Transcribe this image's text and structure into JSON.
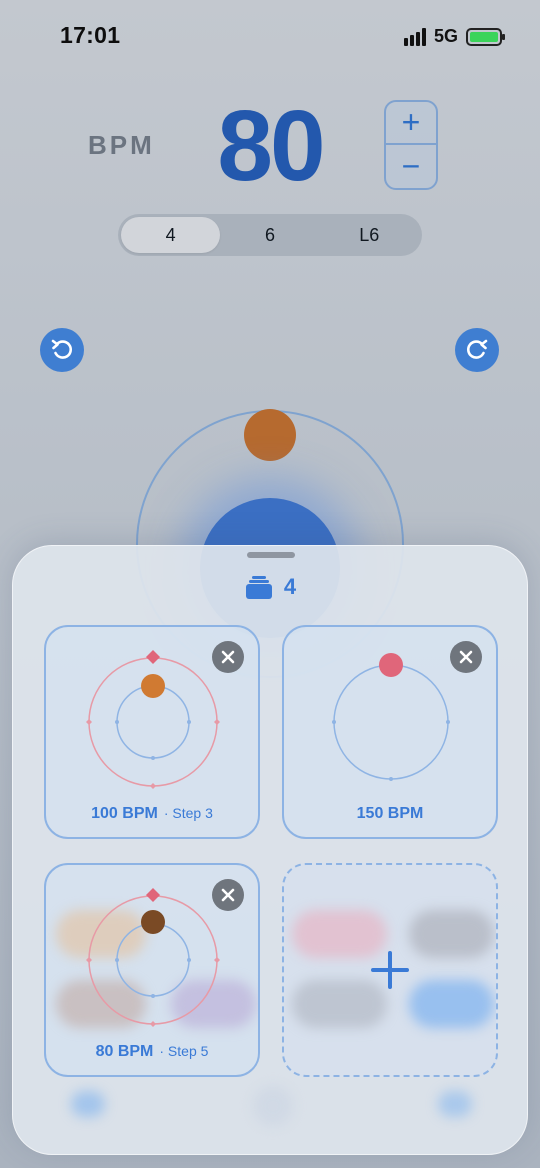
{
  "status_bar": {
    "time": "17:01",
    "network": "5G"
  },
  "tempo": {
    "label": "BPM",
    "value": "80",
    "increase_label": "+",
    "decrease_label": "−"
  },
  "meter": {
    "options": [
      "4",
      "6",
      "L6"
    ],
    "selected": "4"
  },
  "colors": {
    "accent": "#3a7ad6",
    "tempo_text": "#2358ad",
    "beat_dot": "#b66a2f",
    "accent_beat": "#e0667a"
  },
  "sheet": {
    "title": "4",
    "presets": [
      {
        "bpm_label": "100 BPM",
        "step_label": "· Step 3"
      },
      {
        "bpm_label": "150 BPM",
        "step_label": ""
      },
      {
        "bpm_label": "80 BPM",
        "step_label": "· Step 5"
      }
    ],
    "add_label": "+"
  },
  "icons": [
    "rotate-left-icon",
    "rotate-right-icon",
    "close-icon",
    "stack-icon",
    "plus-icon"
  ]
}
